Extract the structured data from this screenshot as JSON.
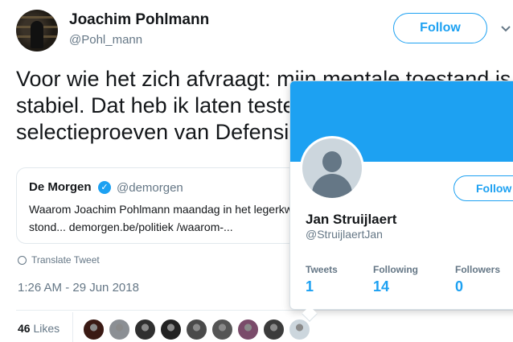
{
  "tweet": {
    "author_name": "Joachim Pohlmann",
    "author_handle": "@Pohl_mann",
    "follow_label": "Follow",
    "text": "Voor wie het zich afvraagt: mijn mentale toestand is stabiel. Dat heb ik laten testen via de selectieproeven van Defensie.",
    "quote": {
      "name": "De Morgen",
      "handle": "@demorgen",
      "text": "Waarom Joachim Pohlmann maandag in het legerkwartier stond... demorgen.be/politiek /waarom-..."
    },
    "translate_label": "Translate Tweet",
    "timestamp": "1:26 AM - 29 Jun 2018",
    "likes_count": "46",
    "likes_label": "Likes",
    "liker_colors": [
      "#3a1a14",
      "#8b8f94",
      "#2f2f2f",
      "#222222",
      "#4a4a4a",
      "#555555",
      "#7a4b6a",
      "#3b3b3b",
      "#ccd6dd"
    ]
  },
  "hover_card": {
    "banner_color": "#1da1f2",
    "name": "Jan Struijlaert",
    "handle": "@StruijlaertJan",
    "follow_label": "Follow",
    "stats": [
      {
        "label": "Tweets",
        "value": "1"
      },
      {
        "label": "Following",
        "value": "14"
      },
      {
        "label": "Followers",
        "value": "0"
      }
    ]
  },
  "icons": [
    "more-chevron-icon",
    "verified-badge-icon",
    "globe-icon",
    "default-avatar-icon"
  ]
}
